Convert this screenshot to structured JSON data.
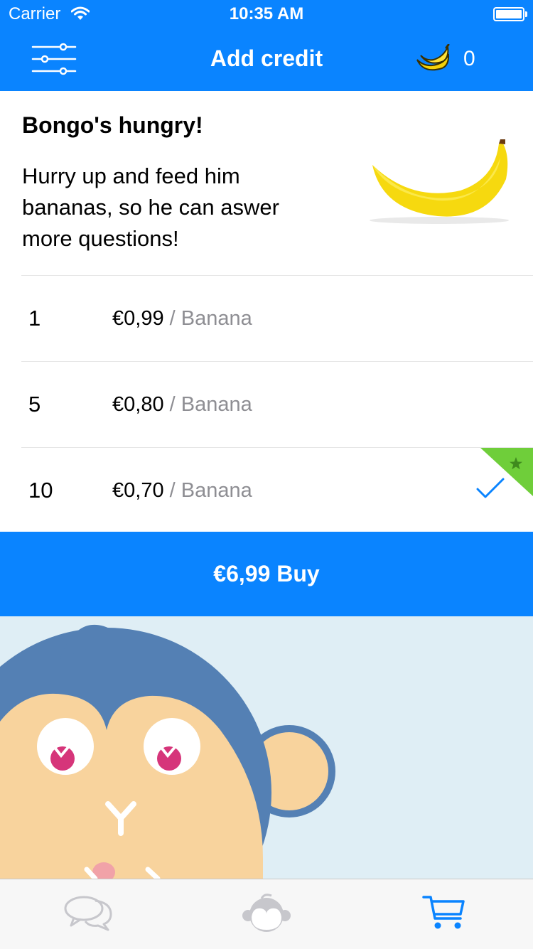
{
  "status_bar": {
    "carrier": "Carrier",
    "time": "10:35 AM"
  },
  "nav": {
    "title": "Add credit",
    "banana_count": "0",
    "icons": {
      "menu": "sliders-menu-icon",
      "banana": "banana-icon"
    }
  },
  "intro": {
    "heading": "Bongo's hungry!",
    "body": "Hurry up and feed him bananas, so he can aswer more questions!"
  },
  "offers": [
    {
      "qty": "1",
      "price": "€0,99",
      "unit": "/ Banana",
      "selected": false
    },
    {
      "qty": "5",
      "price": "€0,80",
      "unit": "/ Banana",
      "selected": false
    },
    {
      "qty": "10",
      "price": "€0,70",
      "unit": "/ Banana",
      "selected": true,
      "badge": "star-badge"
    }
  ],
  "buy_button": {
    "label": "€6,99 Buy"
  },
  "tabs": [
    {
      "icon": "chat-bubbles-icon",
      "active": false
    },
    {
      "icon": "monkey-icon",
      "active": false
    },
    {
      "icon": "shopping-cart-icon",
      "active": true
    }
  ],
  "colors": {
    "accent": "#0a84ff",
    "badge_green": "#6fce3a",
    "mascot_background": "#dfeef5",
    "inactive_tab": "#c7c7cc"
  }
}
